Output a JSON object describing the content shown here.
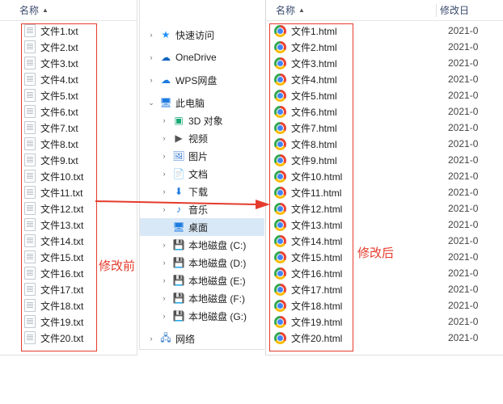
{
  "headers": {
    "name": "名称",
    "date": "修改日"
  },
  "labels": {
    "before": "修改前",
    "after": "修改后"
  },
  "leftFiles": [
    "文件1.txt",
    "文件2.txt",
    "文件3.txt",
    "文件4.txt",
    "文件5.txt",
    "文件6.txt",
    "文件7.txt",
    "文件8.txt",
    "文件9.txt",
    "文件10.txt",
    "文件11.txt",
    "文件12.txt",
    "文件13.txt",
    "文件14.txt",
    "文件15.txt",
    "文件16.txt",
    "文件17.txt",
    "文件18.txt",
    "文件19.txt",
    "文件20.txt"
  ],
  "rightFiles": [
    {
      "name": "文件1.html",
      "date": "2021-0"
    },
    {
      "name": "文件2.html",
      "date": "2021-0"
    },
    {
      "name": "文件3.html",
      "date": "2021-0"
    },
    {
      "name": "文件4.html",
      "date": "2021-0"
    },
    {
      "name": "文件5.html",
      "date": "2021-0"
    },
    {
      "name": "文件6.html",
      "date": "2021-0"
    },
    {
      "name": "文件7.html",
      "date": "2021-0"
    },
    {
      "name": "文件8.html",
      "date": "2021-0"
    },
    {
      "name": "文件9.html",
      "date": "2021-0"
    },
    {
      "name": "文件10.html",
      "date": "2021-0"
    },
    {
      "name": "文件11.html",
      "date": "2021-0"
    },
    {
      "name": "文件12.html",
      "date": "2021-0"
    },
    {
      "name": "文件13.html",
      "date": "2021-0"
    },
    {
      "name": "文件14.html",
      "date": "2021-0"
    },
    {
      "name": "文件15.html",
      "date": "2021-0"
    },
    {
      "name": "文件16.html",
      "date": "2021-0"
    },
    {
      "name": "文件17.html",
      "date": "2021-0"
    },
    {
      "name": "文件18.html",
      "date": "2021-0"
    },
    {
      "name": "文件19.html",
      "date": "2021-0"
    },
    {
      "name": "文件20.html",
      "date": "2021-0"
    }
  ],
  "nav": [
    {
      "level": 1,
      "chev": ">",
      "iconClass": "ico-star",
      "glyph": "★",
      "label": "快速访问",
      "sel": false,
      "name": "nav-quick-access"
    },
    {
      "level": 1,
      "chev": ">",
      "iconClass": "ico-cloud",
      "glyph": "☁",
      "label": "OneDrive",
      "sel": false,
      "name": "nav-onedrive"
    },
    {
      "level": 1,
      "chev": ">",
      "iconClass": "ico-wps",
      "glyph": "☁",
      "label": "WPS网盘",
      "sel": false,
      "name": "nav-wps"
    },
    {
      "level": 1,
      "chev": "v",
      "iconClass": "ico-pc",
      "glyph": "🖥",
      "label": "此电脑",
      "sel": false,
      "name": "nav-this-pc"
    },
    {
      "level": 2,
      "chev": ">",
      "iconClass": "ico-3d",
      "glyph": "▣",
      "label": "3D 对象",
      "sel": false,
      "name": "nav-3d"
    },
    {
      "level": 2,
      "chev": ">",
      "iconClass": "ico-video",
      "glyph": "▶",
      "label": "视频",
      "sel": false,
      "name": "nav-video"
    },
    {
      "level": 2,
      "chev": ">",
      "iconClass": "ico-pic",
      "glyph": "🖼",
      "label": "图片",
      "sel": false,
      "name": "nav-pictures"
    },
    {
      "level": 2,
      "chev": ">",
      "iconClass": "ico-doc",
      "glyph": "📄",
      "label": "文档",
      "sel": false,
      "name": "nav-docs"
    },
    {
      "level": 2,
      "chev": ">",
      "iconClass": "ico-dl",
      "glyph": "⬇",
      "label": "下载",
      "sel": false,
      "name": "nav-downloads"
    },
    {
      "level": 2,
      "chev": ">",
      "iconClass": "ico-music",
      "glyph": "♪",
      "label": "音乐",
      "sel": false,
      "name": "nav-music"
    },
    {
      "level": 2,
      "chev": "",
      "iconClass": "ico-desk",
      "glyph": "🖥",
      "label": "桌面",
      "sel": true,
      "name": "nav-desktop"
    },
    {
      "level": 2,
      "chev": ">",
      "iconClass": "ico-disk",
      "glyph": "💾",
      "label": "本地磁盘 (C:)",
      "sel": false,
      "name": "nav-disk-c"
    },
    {
      "level": 2,
      "chev": ">",
      "iconClass": "ico-disk",
      "glyph": "💾",
      "label": "本地磁盘 (D:)",
      "sel": false,
      "name": "nav-disk-d"
    },
    {
      "level": 2,
      "chev": ">",
      "iconClass": "ico-disk",
      "glyph": "💾",
      "label": "本地磁盘 (E:)",
      "sel": false,
      "name": "nav-disk-e"
    },
    {
      "level": 2,
      "chev": ">",
      "iconClass": "ico-disk",
      "glyph": "💾",
      "label": "本地磁盘 (F:)",
      "sel": false,
      "name": "nav-disk-f"
    },
    {
      "level": 2,
      "chev": ">",
      "iconClass": "ico-disk",
      "glyph": "💾",
      "label": "本地磁盘 (G:)",
      "sel": false,
      "name": "nav-disk-g"
    },
    {
      "level": 1,
      "chev": ">",
      "iconClass": "ico-net",
      "glyph": "🖧",
      "label": "网络",
      "sel": false,
      "name": "nav-network"
    }
  ]
}
